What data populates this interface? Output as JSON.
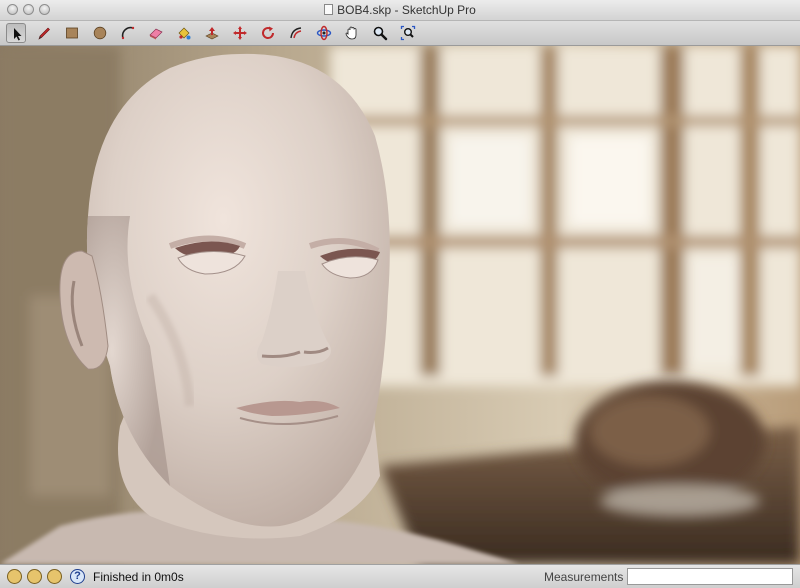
{
  "window": {
    "title": "BOB4.skp - SketchUp Pro"
  },
  "toolbar": {
    "tools": [
      {
        "name": "select",
        "icon": "select-arrow-icon",
        "active": true
      },
      {
        "name": "pencil",
        "icon": "pencil-icon"
      },
      {
        "name": "rectangle",
        "icon": "rectangle-icon"
      },
      {
        "name": "circle",
        "icon": "circle-icon"
      },
      {
        "name": "arc",
        "icon": "arc-icon"
      },
      {
        "name": "eraser",
        "icon": "eraser-icon"
      },
      {
        "name": "paint-bucket",
        "icon": "paint-bucket-icon"
      },
      {
        "name": "push-pull",
        "icon": "push-pull-icon"
      },
      {
        "name": "move",
        "icon": "move-icon"
      },
      {
        "name": "rotate",
        "icon": "rotate-icon"
      },
      {
        "name": "offset",
        "icon": "offset-icon"
      },
      {
        "name": "orbit",
        "icon": "orbit-icon"
      },
      {
        "name": "pan",
        "icon": "pan-hand-icon"
      },
      {
        "name": "zoom",
        "icon": "zoom-icon"
      },
      {
        "name": "zoom-extents",
        "icon": "zoom-extents-icon"
      }
    ]
  },
  "statusbar": {
    "message": "Finished in 0m0s",
    "measurements_label": "Measurements",
    "measurements_value": ""
  },
  "colors": {
    "accent_red": "#c0292b",
    "toolbar_bg": "#d6d6d6"
  }
}
